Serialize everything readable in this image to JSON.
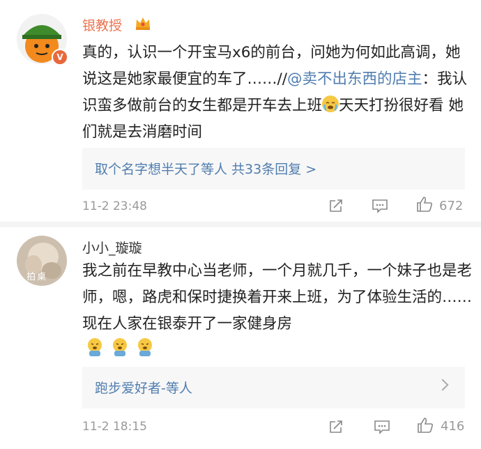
{
  "comments": [
    {
      "author": "银教授",
      "text_part1": "真的，认识一个开宝马x6的前台，问她为何如此高调，她说这是她家最便宜的车了……//",
      "mention": "@卖不出东西的店主",
      "text_part2": "：我认识蛮多做前台的女生都是开车去上班",
      "text_part3": "天天打扮很好看 她们就是去消磨时间",
      "reply_summary": "取个名字想半天了等人 共33条回复 >",
      "time": "11-2 23:48",
      "likes": "672",
      "badge": "V"
    },
    {
      "author": "小小_璇璇",
      "avatar_label": "拍桌",
      "text": "我之前在早教中心当老师，一个月就几千，一个妹子也是老师，嗯，路虎和保时捷换着开来上班，为了体验生活的……现在人家在银泰开了一家健身房",
      "reply_summary": "跑步爱好者-等人",
      "time": "11-2 18:15",
      "likes": "416"
    }
  ],
  "colors": {
    "link": "#507daf",
    "name_vip": "#eb7350",
    "meta": "#999999"
  },
  "icons": [
    "crown-icon",
    "share-icon",
    "comment-icon",
    "like-icon",
    "cry-emoji-icon",
    "chevron-right-icon"
  ]
}
